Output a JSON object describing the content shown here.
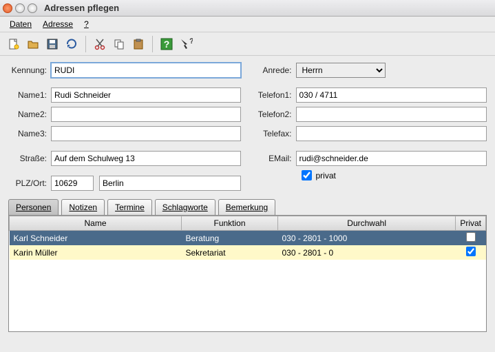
{
  "window": {
    "title": "Adressen pflegen"
  },
  "menu": {
    "items": [
      "Daten",
      "Adresse",
      "?"
    ]
  },
  "toolbar": {
    "icons": [
      "new",
      "open",
      "save",
      "refresh",
      "cut",
      "copy",
      "paste",
      "help",
      "whatsthis"
    ]
  },
  "form": {
    "left": {
      "kennung": {
        "label": "Kennung:",
        "value": "RUDI"
      },
      "name1": {
        "label": "Name1:",
        "value": "Rudi Schneider"
      },
      "name2": {
        "label": "Name2:",
        "value": ""
      },
      "name3": {
        "label": "Name3:",
        "value": ""
      },
      "strasse": {
        "label": "Straße:",
        "value": "Auf dem Schulweg 13"
      },
      "plzort": {
        "label": "PLZ/Ort:",
        "plz": "10629",
        "ort": "Berlin"
      }
    },
    "right": {
      "anrede": {
        "label": "Anrede:",
        "value": "Herrn"
      },
      "telefon1": {
        "label": "Telefon1:",
        "value": "030 / 4711"
      },
      "telefon2": {
        "label": "Telefon2:",
        "value": ""
      },
      "telefax": {
        "label": "Telefax:",
        "value": ""
      },
      "email": {
        "label": "EMail:",
        "value": "rudi@schneider.de"
      },
      "privat": {
        "label": "privat",
        "checked": true
      }
    }
  },
  "tabs": {
    "items": [
      "Personen",
      "Notizen",
      "Termine",
      "Schlagworte",
      "Bemerkung"
    ],
    "active": 0
  },
  "table": {
    "headers": {
      "name": "Name",
      "funktion": "Funktion",
      "durchwahl": "Durchwahl",
      "privat": "Privat"
    },
    "rows": [
      {
        "name": "Karl Schneider",
        "funktion": "Beratung",
        "durchwahl": "030 - 2801 - 1000",
        "privat": false,
        "selected": true
      },
      {
        "name": "Karin Müller",
        "funktion": "Sekretariat",
        "durchwahl": "030 - 2801 - 0",
        "privat": true,
        "selected": false
      }
    ]
  }
}
